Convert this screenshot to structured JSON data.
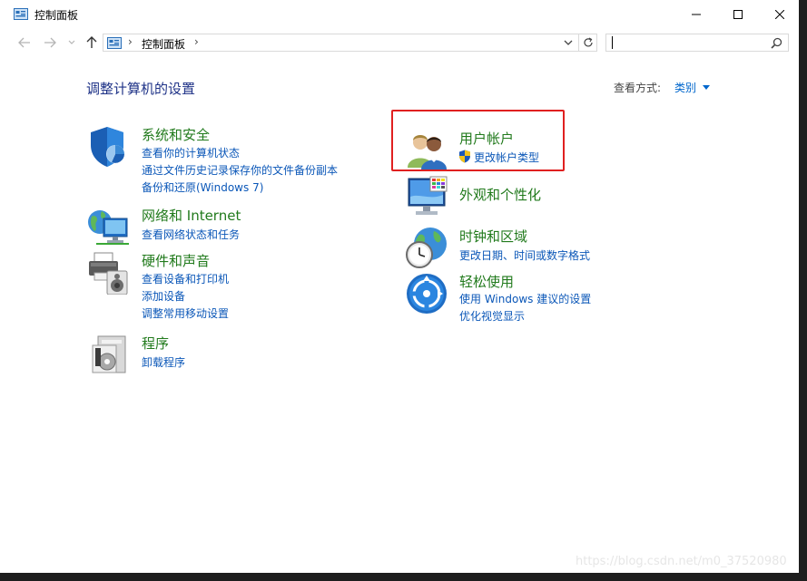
{
  "window": {
    "title": "控制面板"
  },
  "address": {
    "path": "控制面板",
    "separator": "›"
  },
  "search": {
    "placeholder": "",
    "value": ""
  },
  "content": {
    "title": "调整计算机的设置",
    "viewby_label": "查看方式:",
    "viewby_value": "类别"
  },
  "categories": {
    "system_security": {
      "title": "系统和安全",
      "links": [
        "查看你的计算机状态",
        "通过文件历史记录保存你的文件备份副本",
        "备份和还原(Windows 7)"
      ]
    },
    "network": {
      "title": "网络和 Internet",
      "links": [
        "查看网络状态和任务"
      ]
    },
    "hardware": {
      "title": "硬件和声音",
      "links": [
        "查看设备和打印机",
        "添加设备",
        "调整常用移动设置"
      ]
    },
    "programs": {
      "title": "程序",
      "links": [
        "卸载程序"
      ]
    },
    "user_accounts": {
      "title": "用户帐户",
      "links": [
        "更改帐户类型"
      ]
    },
    "appearance": {
      "title": "外观和个性化",
      "links": []
    },
    "clock_region": {
      "title": "时钟和区域",
      "links": [
        "更改日期、时间或数字格式"
      ]
    },
    "ease_access": {
      "title": "轻松使用",
      "links": [
        "使用 Windows 建议的设置",
        "优化视觉显示"
      ]
    }
  },
  "watermark": "https://blog.csdn.net/m0_37520980",
  "colors": {
    "category_title": "#217a1c",
    "link": "#0b57b8",
    "page_title": "#1e3287",
    "highlight": "#e02020"
  }
}
